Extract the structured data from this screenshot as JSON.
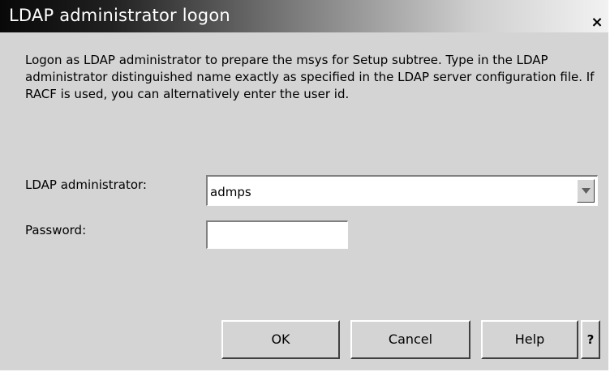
{
  "window": {
    "title": "LDAP administrator logon",
    "close_label": "×"
  },
  "description": "Logon as LDAP administrator to prepare the msys for Setup subtree. Type in the LDAP administrator distinguished name exactly as specified in the LDAP server configuration file. If RACF is used, you can alternatively enter the user id.",
  "form": {
    "admin_label": "LDAP administrator:",
    "admin_value": "admps",
    "password_label": "Password:",
    "password_value": ""
  },
  "buttons": {
    "ok": "OK",
    "cancel": "Cancel",
    "help": "Help",
    "context_help": "?"
  }
}
